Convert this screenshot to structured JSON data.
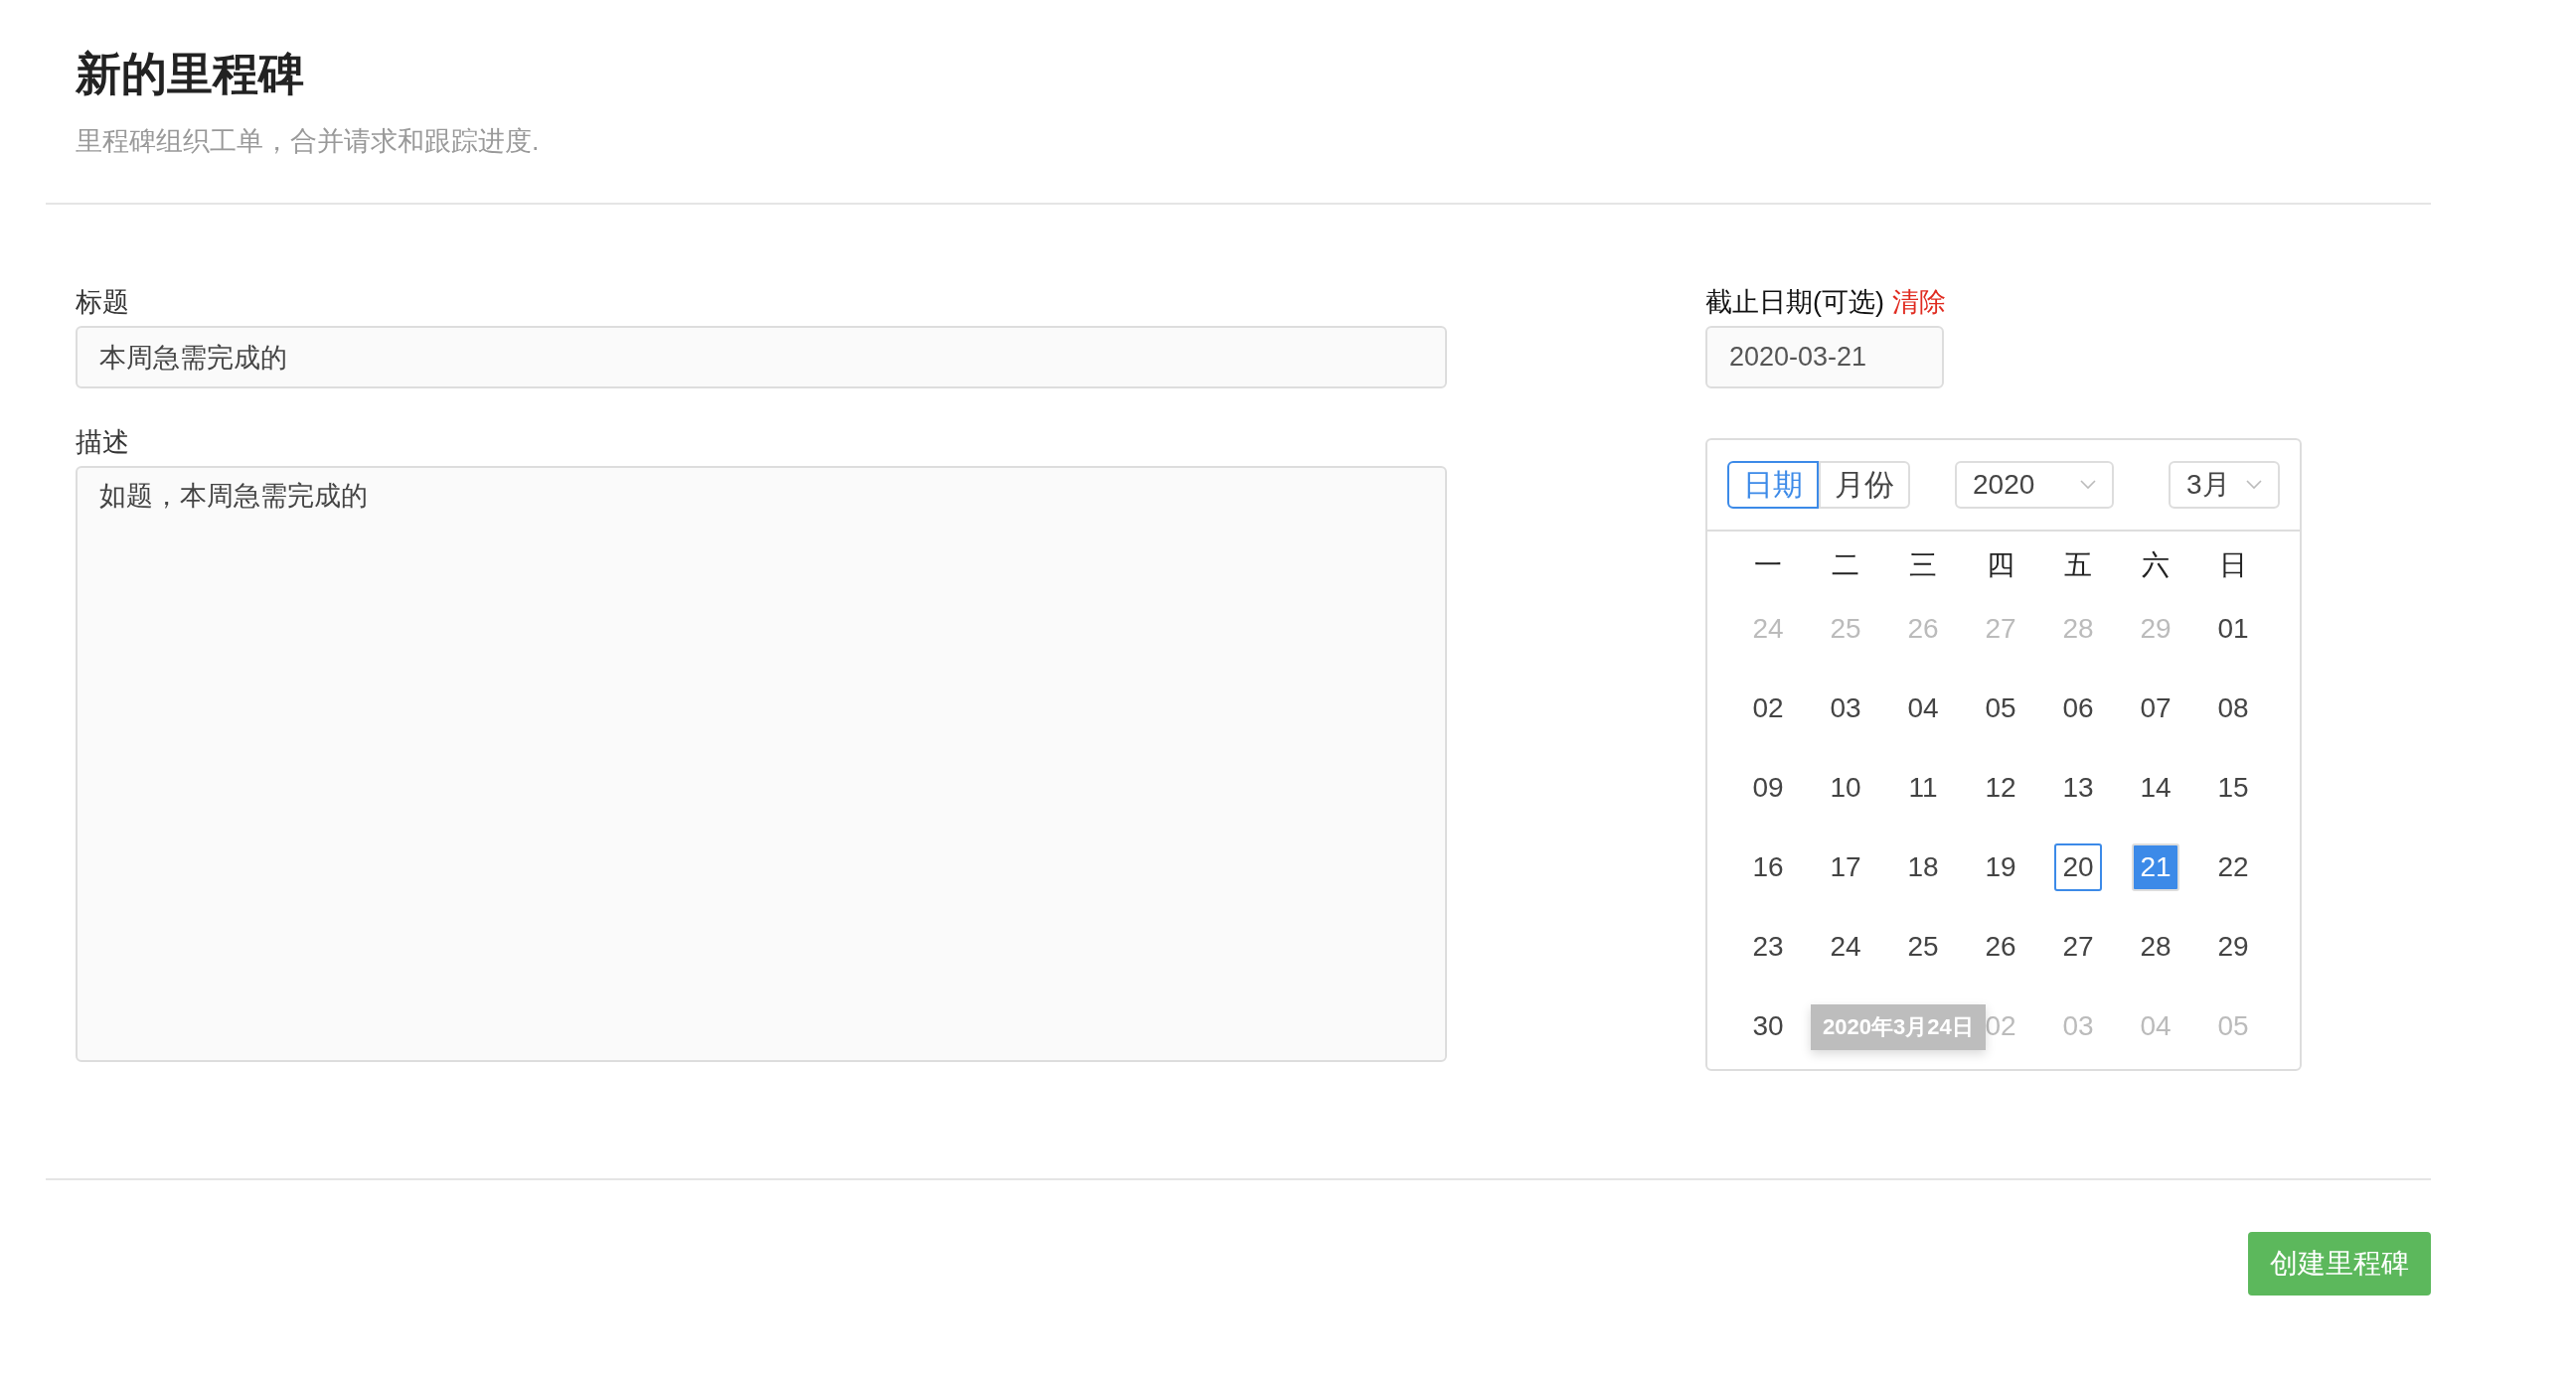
{
  "header": {
    "title": "新的里程碑",
    "subtitle": "里程碑组织工单，合并请求和跟踪进度."
  },
  "form": {
    "title_field": {
      "label": "标题",
      "value": "本周急需完成的"
    },
    "description_field": {
      "label": "描述",
      "value": "如题，本周急需完成的"
    },
    "due_date": {
      "label": "截止日期(可选)",
      "clear_link": "清除",
      "value": "2020-03-21"
    }
  },
  "calendar": {
    "tabs": [
      {
        "label": "日期",
        "selected": true
      },
      {
        "label": "月份",
        "selected": false
      }
    ],
    "year": "2020",
    "month": "3月",
    "weekdays": [
      "一",
      "二",
      "三",
      "四",
      "五",
      "六",
      "日"
    ],
    "weeks": [
      [
        {
          "day": "24",
          "kind": "outside",
          "today": false,
          "selected": false
        },
        {
          "day": "25",
          "kind": "outside",
          "today": false,
          "selected": false
        },
        {
          "day": "26",
          "kind": "outside",
          "today": false,
          "selected": false
        },
        {
          "day": "27",
          "kind": "outside",
          "today": false,
          "selected": false
        },
        {
          "day": "28",
          "kind": "outside",
          "today": false,
          "selected": false
        },
        {
          "day": "29",
          "kind": "outside",
          "today": false,
          "selected": false
        },
        {
          "day": "01",
          "kind": "month",
          "today": false,
          "selected": false
        }
      ],
      [
        {
          "day": "02",
          "kind": "month",
          "today": false,
          "selected": false
        },
        {
          "day": "03",
          "kind": "month",
          "today": false,
          "selected": false
        },
        {
          "day": "04",
          "kind": "month",
          "today": false,
          "selected": false
        },
        {
          "day": "05",
          "kind": "month",
          "today": false,
          "selected": false
        },
        {
          "day": "06",
          "kind": "month",
          "today": false,
          "selected": false
        },
        {
          "day": "07",
          "kind": "month",
          "today": false,
          "selected": false
        },
        {
          "day": "08",
          "kind": "month",
          "today": false,
          "selected": false
        }
      ],
      [
        {
          "day": "09",
          "kind": "month",
          "today": false,
          "selected": false
        },
        {
          "day": "10",
          "kind": "month",
          "today": false,
          "selected": false
        },
        {
          "day": "11",
          "kind": "month",
          "today": false,
          "selected": false
        },
        {
          "day": "12",
          "kind": "month",
          "today": false,
          "selected": false
        },
        {
          "day": "13",
          "kind": "month",
          "today": false,
          "selected": false
        },
        {
          "day": "14",
          "kind": "month",
          "today": false,
          "selected": false
        },
        {
          "day": "15",
          "kind": "month",
          "today": false,
          "selected": false
        }
      ],
      [
        {
          "day": "16",
          "kind": "month",
          "today": false,
          "selected": false
        },
        {
          "day": "17",
          "kind": "month",
          "today": false,
          "selected": false
        },
        {
          "day": "18",
          "kind": "month",
          "today": false,
          "selected": false
        },
        {
          "day": "19",
          "kind": "month",
          "today": false,
          "selected": false
        },
        {
          "day": "20",
          "kind": "month",
          "today": true,
          "selected": false
        },
        {
          "day": "21",
          "kind": "month",
          "today": false,
          "selected": true
        },
        {
          "day": "22",
          "kind": "month",
          "today": false,
          "selected": false
        }
      ],
      [
        {
          "day": "23",
          "kind": "month",
          "today": false,
          "selected": false
        },
        {
          "day": "24",
          "kind": "month",
          "today": false,
          "selected": false
        },
        {
          "day": "25",
          "kind": "month",
          "today": false,
          "selected": false
        },
        {
          "day": "26",
          "kind": "month",
          "today": false,
          "selected": false
        },
        {
          "day": "27",
          "kind": "month",
          "today": false,
          "selected": false
        },
        {
          "day": "28",
          "kind": "month",
          "today": false,
          "selected": false
        },
        {
          "day": "29",
          "kind": "month",
          "today": false,
          "selected": false
        }
      ],
      [
        {
          "day": "30",
          "kind": "month",
          "today": false,
          "selected": false
        },
        {
          "kind": "covered"
        },
        {
          "kind": "covered"
        },
        {
          "day": "02",
          "kind": "outside",
          "today": false,
          "selected": false
        },
        {
          "day": "03",
          "kind": "outside",
          "today": false,
          "selected": false
        },
        {
          "day": "04",
          "kind": "outside",
          "today": false,
          "selected": false
        },
        {
          "day": "05",
          "kind": "outside",
          "today": false,
          "selected": false
        }
      ]
    ],
    "tooltip": "2020年3月24日"
  },
  "submit_button": "创建里程碑"
}
